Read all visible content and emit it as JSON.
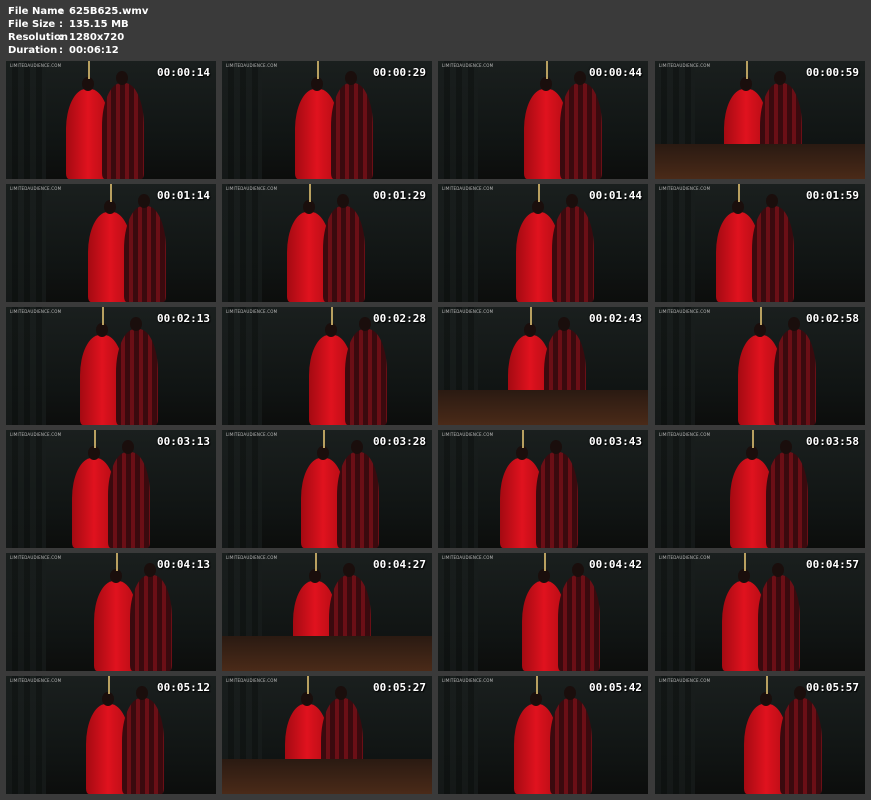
{
  "info": {
    "file_name_label": "File Name",
    "file_name": "625B625.wmv",
    "file_size_label": "File Size",
    "file_size": "135.15 MB",
    "resolution_label": "Resolution",
    "resolution": "1280x720",
    "duration_label": "Duration",
    "duration": "00:06:12",
    "separator": ":"
  },
  "watermark": "LIMITEDAUDIENCE.COM",
  "thumbnails": [
    {
      "time": "00:00:14"
    },
    {
      "time": "00:00:29"
    },
    {
      "time": "00:00:44"
    },
    {
      "time": "00:00:59"
    },
    {
      "time": "00:01:14"
    },
    {
      "time": "00:01:29"
    },
    {
      "time": "00:01:44"
    },
    {
      "time": "00:01:59"
    },
    {
      "time": "00:02:13"
    },
    {
      "time": "00:02:28"
    },
    {
      "time": "00:02:43"
    },
    {
      "time": "00:02:58"
    },
    {
      "time": "00:03:13"
    },
    {
      "time": "00:03:28"
    },
    {
      "time": "00:03:43"
    },
    {
      "time": "00:03:58"
    },
    {
      "time": "00:04:13"
    },
    {
      "time": "00:04:27"
    },
    {
      "time": "00:04:42"
    },
    {
      "time": "00:04:57"
    },
    {
      "time": "00:05:12"
    },
    {
      "time": "00:05:27"
    },
    {
      "time": "00:05:42"
    },
    {
      "time": "00:05:57"
    }
  ]
}
